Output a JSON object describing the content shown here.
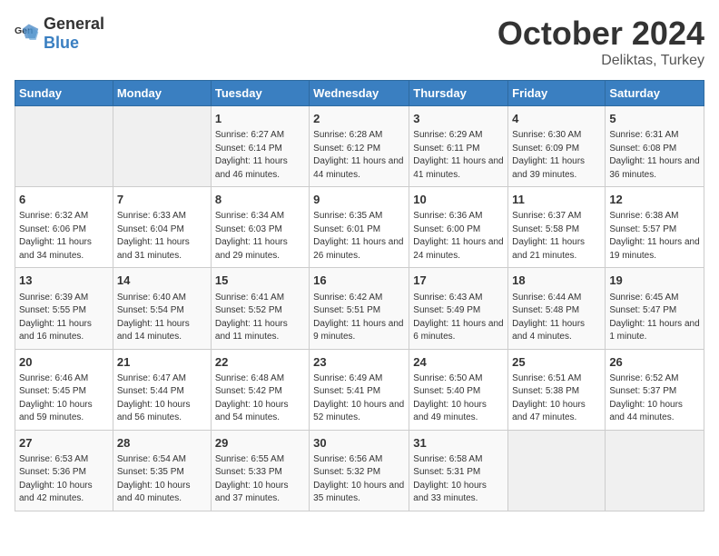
{
  "logo": {
    "general": "General",
    "blue": "Blue"
  },
  "title": {
    "month": "October 2024",
    "location": "Deliktas, Turkey"
  },
  "headers": [
    "Sunday",
    "Monday",
    "Tuesday",
    "Wednesday",
    "Thursday",
    "Friday",
    "Saturday"
  ],
  "weeks": [
    [
      {
        "day": "",
        "info": ""
      },
      {
        "day": "",
        "info": ""
      },
      {
        "day": "1",
        "info": "Sunrise: 6:27 AM\nSunset: 6:14 PM\nDaylight: 11 hours and 46 minutes."
      },
      {
        "day": "2",
        "info": "Sunrise: 6:28 AM\nSunset: 6:12 PM\nDaylight: 11 hours and 44 minutes."
      },
      {
        "day": "3",
        "info": "Sunrise: 6:29 AM\nSunset: 6:11 PM\nDaylight: 11 hours and 41 minutes."
      },
      {
        "day": "4",
        "info": "Sunrise: 6:30 AM\nSunset: 6:09 PM\nDaylight: 11 hours and 39 minutes."
      },
      {
        "day": "5",
        "info": "Sunrise: 6:31 AM\nSunset: 6:08 PM\nDaylight: 11 hours and 36 minutes."
      }
    ],
    [
      {
        "day": "6",
        "info": "Sunrise: 6:32 AM\nSunset: 6:06 PM\nDaylight: 11 hours and 34 minutes."
      },
      {
        "day": "7",
        "info": "Sunrise: 6:33 AM\nSunset: 6:04 PM\nDaylight: 11 hours and 31 minutes."
      },
      {
        "day": "8",
        "info": "Sunrise: 6:34 AM\nSunset: 6:03 PM\nDaylight: 11 hours and 29 minutes."
      },
      {
        "day": "9",
        "info": "Sunrise: 6:35 AM\nSunset: 6:01 PM\nDaylight: 11 hours and 26 minutes."
      },
      {
        "day": "10",
        "info": "Sunrise: 6:36 AM\nSunset: 6:00 PM\nDaylight: 11 hours and 24 minutes."
      },
      {
        "day": "11",
        "info": "Sunrise: 6:37 AM\nSunset: 5:58 PM\nDaylight: 11 hours and 21 minutes."
      },
      {
        "day": "12",
        "info": "Sunrise: 6:38 AM\nSunset: 5:57 PM\nDaylight: 11 hours and 19 minutes."
      }
    ],
    [
      {
        "day": "13",
        "info": "Sunrise: 6:39 AM\nSunset: 5:55 PM\nDaylight: 11 hours and 16 minutes."
      },
      {
        "day": "14",
        "info": "Sunrise: 6:40 AM\nSunset: 5:54 PM\nDaylight: 11 hours and 14 minutes."
      },
      {
        "day": "15",
        "info": "Sunrise: 6:41 AM\nSunset: 5:52 PM\nDaylight: 11 hours and 11 minutes."
      },
      {
        "day": "16",
        "info": "Sunrise: 6:42 AM\nSunset: 5:51 PM\nDaylight: 11 hours and 9 minutes."
      },
      {
        "day": "17",
        "info": "Sunrise: 6:43 AM\nSunset: 5:49 PM\nDaylight: 11 hours and 6 minutes."
      },
      {
        "day": "18",
        "info": "Sunrise: 6:44 AM\nSunset: 5:48 PM\nDaylight: 11 hours and 4 minutes."
      },
      {
        "day": "19",
        "info": "Sunrise: 6:45 AM\nSunset: 5:47 PM\nDaylight: 11 hours and 1 minute."
      }
    ],
    [
      {
        "day": "20",
        "info": "Sunrise: 6:46 AM\nSunset: 5:45 PM\nDaylight: 10 hours and 59 minutes."
      },
      {
        "day": "21",
        "info": "Sunrise: 6:47 AM\nSunset: 5:44 PM\nDaylight: 10 hours and 56 minutes."
      },
      {
        "day": "22",
        "info": "Sunrise: 6:48 AM\nSunset: 5:42 PM\nDaylight: 10 hours and 54 minutes."
      },
      {
        "day": "23",
        "info": "Sunrise: 6:49 AM\nSunset: 5:41 PM\nDaylight: 10 hours and 52 minutes."
      },
      {
        "day": "24",
        "info": "Sunrise: 6:50 AM\nSunset: 5:40 PM\nDaylight: 10 hours and 49 minutes."
      },
      {
        "day": "25",
        "info": "Sunrise: 6:51 AM\nSunset: 5:38 PM\nDaylight: 10 hours and 47 minutes."
      },
      {
        "day": "26",
        "info": "Sunrise: 6:52 AM\nSunset: 5:37 PM\nDaylight: 10 hours and 44 minutes."
      }
    ],
    [
      {
        "day": "27",
        "info": "Sunrise: 6:53 AM\nSunset: 5:36 PM\nDaylight: 10 hours and 42 minutes."
      },
      {
        "day": "28",
        "info": "Sunrise: 6:54 AM\nSunset: 5:35 PM\nDaylight: 10 hours and 40 minutes."
      },
      {
        "day": "29",
        "info": "Sunrise: 6:55 AM\nSunset: 5:33 PM\nDaylight: 10 hours and 37 minutes."
      },
      {
        "day": "30",
        "info": "Sunrise: 6:56 AM\nSunset: 5:32 PM\nDaylight: 10 hours and 35 minutes."
      },
      {
        "day": "31",
        "info": "Sunrise: 6:58 AM\nSunset: 5:31 PM\nDaylight: 10 hours and 33 minutes."
      },
      {
        "day": "",
        "info": ""
      },
      {
        "day": "",
        "info": ""
      }
    ]
  ]
}
